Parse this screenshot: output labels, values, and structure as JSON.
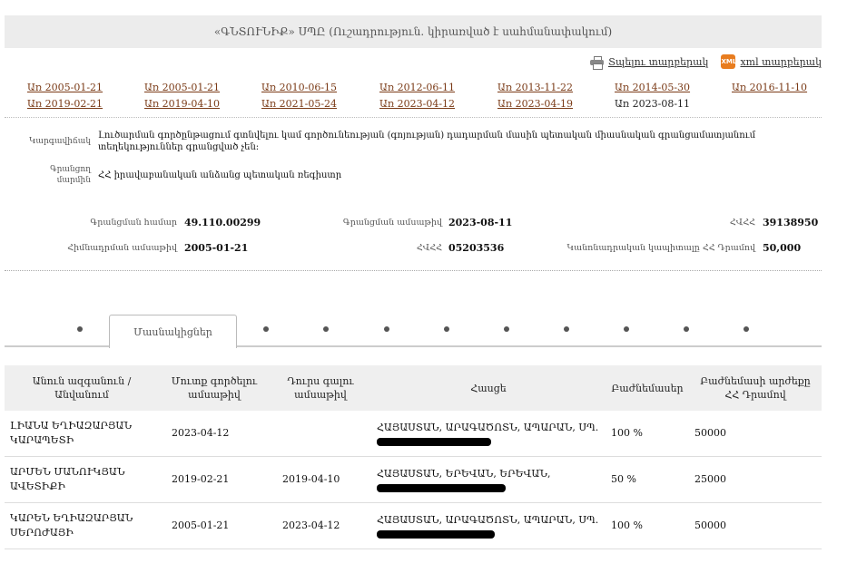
{
  "header": {
    "title": "«ԳՆՏՈՒՆԻՔ» ՍՊԸ (Ուշադրություն. կիրառված է սահմանափակում)"
  },
  "exports": {
    "print_label": "Տպելու տարբերակ",
    "xml_badge": "XML",
    "xml_label": "xml տարբերակ"
  },
  "dates": [
    {
      "label": "Առ 2005-01-21",
      "link": true
    },
    {
      "label": "Առ 2005-01-21",
      "link": true
    },
    {
      "label": "Առ 2010-06-15",
      "link": true
    },
    {
      "label": "Առ 2012-06-11",
      "link": true
    },
    {
      "label": "Առ 2013-11-22",
      "link": true
    },
    {
      "label": "Առ 2014-05-30",
      "link": true
    },
    {
      "label": "Առ 2016-11-10",
      "link": true
    },
    {
      "label": "Առ 2019-02-21",
      "link": true
    },
    {
      "label": "Առ 2019-04-10",
      "link": true
    },
    {
      "label": "Առ 2021-05-24",
      "link": true
    },
    {
      "label": "Առ 2023-04-12",
      "link": true
    },
    {
      "label": "Առ 2023-04-19",
      "link": true
    },
    {
      "label": "Առ 2023-08-11",
      "link": false
    }
  ],
  "status": {
    "label": "Կարգավիճակ",
    "value": "Լուծարման գործընթացում գտնվելու կամ գործունեության (գոյության) դադարման մասին պետական միասնական գրանցամատյանում տեղեկություններ գրանցված չեն:"
  },
  "register": {
    "label": "Գրանցող մարմին",
    "value": "ՀՀ իրավաբանական անձանց պետական ռեգիստր"
  },
  "details": {
    "reg_number_label": "Գրանցման համար",
    "reg_number": "49.110.00299",
    "state_reg_date_label": "Գրանցման ամսաթիվ",
    "state_reg_date": "2023-08-11",
    "tin_label": "ՀՎՀՀ",
    "tin": "39138950",
    "founding_date_label": "Հիմնադրման ամսաթիվ",
    "founding_date": "2005-01-21",
    "code_label": "ՀՎՀՀ",
    "code": "05203536",
    "capital_label": "Կանոնադրական կապիտալը ՀՀ Դրամով",
    "capital": "50,000"
  },
  "tabs": {
    "active_label": "Մասնակիցներ",
    "dot_count": 9
  },
  "table": {
    "headers": [
      "Անուն ազգանուն / Անվանում",
      "Մուտք գործելու ամսաթիվ",
      "Դուրս գալու ամսաթիվ",
      "Հասցե",
      "Բաժնեմասեր",
      "Բաժնեմասի արժեքը ՀՀ Դրամով"
    ],
    "rows": [
      {
        "name": "ԼԻԱՆԱ ԵՂԻԱԶԱՐՅԱՆ ԿԱՐԱՊԵՏԻ",
        "in": "2023-04-12",
        "out": "",
        "address": "ՀԱՅԱՍՏԱՆ, ԱՐԱԳԱԾՈՏՆ, ԱՊԱՐԱՆ, ՍՊ.",
        "share": "100 %",
        "value": "50000"
      },
      {
        "name": "ԱՐՄԵՆ ՄԱՆՈՒԿՅԱՆ ԱՎԵՏԻՔԻ",
        "in": "2019-02-21",
        "out": "2019-04-10",
        "address": "ՀԱՅԱՍՏԱՆ, ԵՐԵՎԱՆ, ԵՐԵՎԱՆ,",
        "share": "50 %",
        "value": "25000"
      },
      {
        "name": "ԿԱՐԵՆ ԵՂԻԱԶԱՐՅԱՆ ՍԵՐՈԺԱՅԻ",
        "in": "2005-01-21",
        "out": "2023-04-12",
        "address": "ՀԱՅԱՍՏԱՆ, ԱՐԱԳԱԾՈՏՆ, ԱՊԱՐԱՆ, ՍՊ.",
        "share": "100 %",
        "value": "50000"
      }
    ]
  }
}
